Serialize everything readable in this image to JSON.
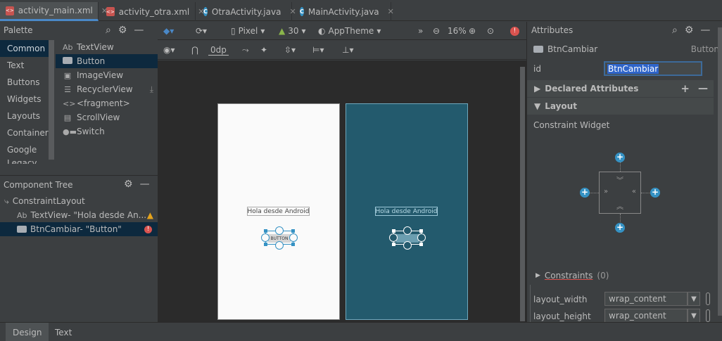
{
  "tabs": [
    {
      "label": "activity_main.xml",
      "icon": "xml-file-icon",
      "active": true
    },
    {
      "label": "activity_otra.xml",
      "icon": "xml-file-icon",
      "active": false
    },
    {
      "label": "OtraActivity.java",
      "icon": "java-class-icon",
      "active": false
    },
    {
      "label": "MainActivity.java",
      "icon": "java-class-icon",
      "active": false
    }
  ],
  "palette": {
    "title": "Palette",
    "categories": [
      "Common",
      "Text",
      "Buttons",
      "Widgets",
      "Layouts",
      "Container",
      "Google",
      "Legacy"
    ],
    "items": [
      {
        "icon": "Ab",
        "label": "TextView"
      },
      {
        "icon": "button",
        "label": "Button"
      },
      {
        "icon": "image",
        "label": "ImageView"
      },
      {
        "icon": "list",
        "label": "RecyclerView"
      },
      {
        "icon": "<>",
        "label": "<fragment>"
      },
      {
        "icon": "scroll",
        "label": "ScrollView"
      },
      {
        "icon": "switch",
        "label": "Switch"
      }
    ]
  },
  "component_tree": {
    "title": "Component Tree",
    "root": "ConstraintLayout",
    "children": [
      {
        "icon": "Ab",
        "label": "TextView- \"Hola desde An...",
        "status": "warning"
      },
      {
        "icon": "button",
        "label": "BtnCambiar- \"Button\"",
        "status": "error"
      }
    ]
  },
  "toolbar": {
    "device": "Pixel",
    "api": "30",
    "theme": "AppTheme",
    "zoom": "16%",
    "margin": "0dp"
  },
  "canvas": {
    "textview_text": "Hola desde Android",
    "button_text": "BUTTON"
  },
  "attributes": {
    "title": "Attributes",
    "component_name": "BtnCambiar",
    "component_type": "Button",
    "id_label": "id",
    "id_value": "BtnCambiar",
    "declared_attributes": "Declared Attributes",
    "layout_section": "Layout",
    "constraint_widget": "Constraint Widget",
    "constraints_label": "Constraints",
    "constraints_count": "(0)",
    "layout_width_label": "layout_width",
    "layout_width_value": "wrap_content",
    "layout_height_label": "layout_height",
    "layout_height_value": "wrap_content"
  },
  "bottom_tabs": [
    "Design",
    "Text"
  ],
  "colors": {
    "accent": "#3592c4",
    "selection": "#0d293e",
    "blueprint": "#235a6d",
    "warning": "#e5a31c",
    "error": "#d9534f"
  }
}
